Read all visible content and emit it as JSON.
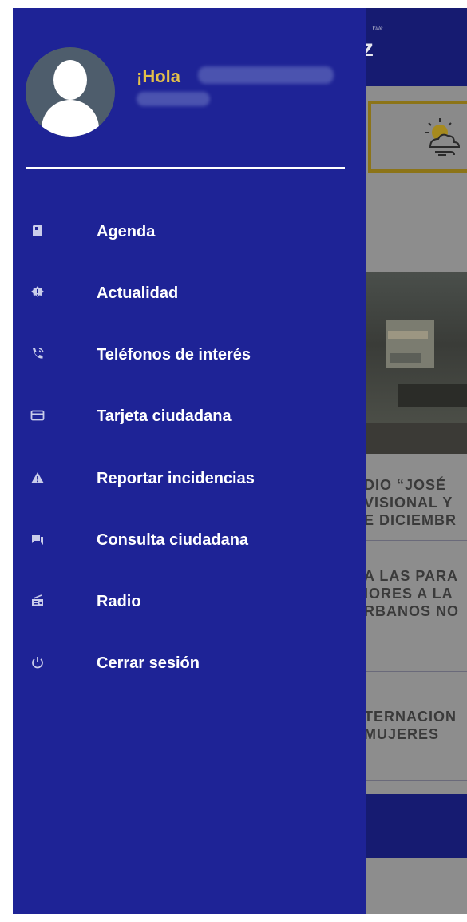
{
  "drawer": {
    "greeting": "¡Hola",
    "menu": [
      {
        "label": "Agenda",
        "icon": "book-icon"
      },
      {
        "label": "Actualidad",
        "icon": "gear-badge-icon"
      },
      {
        "label": "Teléfonos de interés",
        "icon": "phone-icon"
      },
      {
        "label": "Tarjeta ciudadana",
        "icon": "credit-card-icon"
      },
      {
        "label": "Reportar incidencias",
        "icon": "warning-icon"
      },
      {
        "label": "Consulta ciudadana",
        "icon": "chat-icon"
      },
      {
        "label": "Radio",
        "icon": "radio-icon"
      },
      {
        "label": "Cerrar sesión",
        "icon": "power-icon"
      }
    ]
  },
  "background": {
    "logo_small": "Ville",
    "logo": "z",
    "news": [
      {
        "lines": [
          "DIO “JOSÉ",
          "VISIONAL Y",
          "E DICIEMBR"
        ]
      },
      {
        "lines": [
          "A LAS PARA",
          "IORES A LA",
          "RBANOS NO"
        ]
      },
      {
        "lines": [
          "TERNACION",
          "MUJERES"
        ]
      }
    ]
  },
  "colors": {
    "drawer_bg": "#1e2396",
    "header_bg": "#161b71",
    "greeting": "#e4c04a",
    "weather_border": "#8c7418"
  }
}
